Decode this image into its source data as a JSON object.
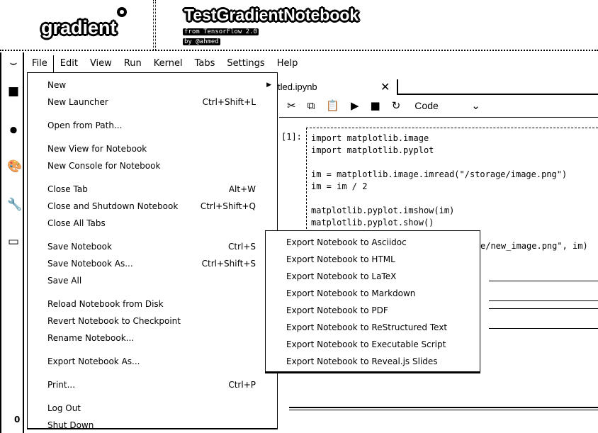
{
  "header": {
    "logo": "gradient",
    "title": "TestGradientNotebook",
    "subtitle": "from TensorFlow 2.0",
    "author": "by @ahmed"
  },
  "menubar": [
    "File",
    "Edit",
    "View",
    "Run",
    "Kernel",
    "Tabs",
    "Settings",
    "Help"
  ],
  "sidebar": {
    "icons": [
      "jupyter-logo-icon",
      "folder-icon",
      "stop-circle-icon",
      "palette-icon",
      "wrench-icon",
      "tabs-icon"
    ],
    "status_count": "0"
  },
  "notebook": {
    "tab_label": "tled.ipynb",
    "cell_type": "Code",
    "prompt": "[1]:",
    "code": [
      "import matplotlib.image",
      "import matplotlib.pyplot",
      "",
      "im = matplotlib.image.imread(\"/storage/image.png\")",
      "im = im / 2",
      "",
      "matplotlib.pyplot.imshow(im)",
      "matplotlib.pyplot.show()"
    ],
    "code_tail": "e/new_image.png\", im)"
  },
  "file_menu": [
    {
      "label": "New",
      "shortcut": "",
      "submenu": true
    },
    {
      "label": "New Launcher",
      "shortcut": "Ctrl+Shift+L"
    },
    {
      "label": "Open from Path...",
      "shortcut": "",
      "sep": true
    },
    {
      "label": "New View for Notebook",
      "shortcut": "",
      "sep": true
    },
    {
      "label": "New Console for Notebook",
      "shortcut": ""
    },
    {
      "label": "Close Tab",
      "shortcut": "Alt+W",
      "sep": true
    },
    {
      "label": "Close and Shutdown Notebook",
      "shortcut": "Ctrl+Shift+Q"
    },
    {
      "label": "Close All Tabs",
      "shortcut": ""
    },
    {
      "label": "Save Notebook",
      "shortcut": "Ctrl+S",
      "sep": true
    },
    {
      "label": "Save Notebook As...",
      "shortcut": "Ctrl+Shift+S"
    },
    {
      "label": "Save All",
      "shortcut": ""
    },
    {
      "label": "Reload Notebook from Disk",
      "shortcut": "",
      "sep": true
    },
    {
      "label": "Revert Notebook to Checkpoint",
      "shortcut": ""
    },
    {
      "label": "Rename Notebook...",
      "shortcut": ""
    },
    {
      "label": "Export Notebook As...",
      "shortcut": "",
      "submenu": true,
      "sep": true
    },
    {
      "label": "Print...",
      "shortcut": "Ctrl+P",
      "sep": true
    },
    {
      "label": "Log Out",
      "shortcut": "",
      "sep": true
    },
    {
      "label": "Shut Down",
      "shortcut": ""
    }
  ],
  "export_menu": [
    "Export Notebook to Asciidoc",
    "Export Notebook to HTML",
    "Export Notebook to LaTeX",
    "Export Notebook to Markdown",
    "Export Notebook to PDF",
    "Export Notebook to ReStructured Text",
    "Export Notebook to Executable Script",
    "Export Notebook to Reveal.js Slides"
  ]
}
